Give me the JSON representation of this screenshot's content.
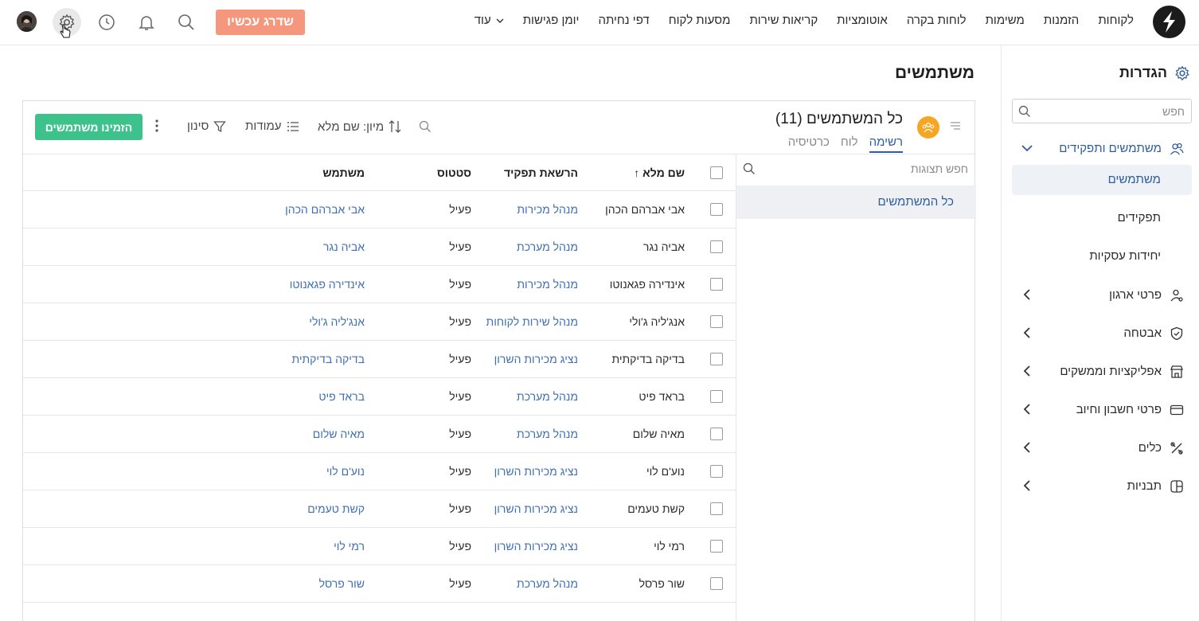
{
  "topbar": {
    "nav_items": [
      "לקוחות",
      "הזמנות",
      "משימות",
      "לוחות בקרה",
      "אוטומציות",
      "קריאות שירות",
      "מסעות לקוח",
      "דפי נחיתה",
      "יומן פגישות"
    ],
    "more_label": "עוד",
    "upgrade_label": "שדרג עכשיו"
  },
  "sidebar": {
    "title": "הגדרות",
    "search_placeholder": "חפש",
    "groups": [
      {
        "label": "משתמשים ותפקידים",
        "icon": "users-icon",
        "expanded": true
      },
      {
        "label": "פרטי ארגון",
        "icon": "org-user-icon"
      },
      {
        "label": "אבטחה",
        "icon": "shield-icon"
      },
      {
        "label": "אפליקציות וממשקים",
        "icon": "store-icon"
      },
      {
        "label": "פרטי חשבון וחיוב",
        "icon": "credit-card-icon"
      },
      {
        "label": "כלים",
        "icon": "tools-icon"
      },
      {
        "label": "תבניות",
        "icon": "template-icon"
      }
    ],
    "sub_items": [
      "משתמשים",
      "תפקידים",
      "יחידות עסקיות"
    ]
  },
  "page": {
    "title": "משתמשים"
  },
  "card": {
    "title": "כל המשתמשים (11)",
    "tabs": [
      "רשימה",
      "לוח",
      "כרטיסיה"
    ],
    "invite_label": "הזמינו משתמשים",
    "filter_label": "סינון",
    "columns_label": "עמודות",
    "sort_label": "מיון: שם מלא",
    "views_search_placeholder": "חפש תצוגות",
    "views": [
      "כל המשתמשים"
    ]
  },
  "table": {
    "headers": {
      "name": "שם מלא",
      "role": "הרשאת תפקיד",
      "status": "סטטוס",
      "user": "משתמש"
    },
    "sort_arrow": "↑",
    "rows": [
      {
        "name": "אבי אברהם הכהן",
        "role": "מנהל מכירות",
        "status": "פעיל",
        "user": "אבי אברהם הכהן"
      },
      {
        "name": "אביה נגר",
        "role": "מנהל מערכת",
        "status": "פעיל",
        "user": "אביה נגר"
      },
      {
        "name": "אינדירה פגאנוטו",
        "role": "מנהל מכירות",
        "status": "פעיל",
        "user": "אינדירה פגאנוטו"
      },
      {
        "name": "אנג'ליה ג'ולי",
        "role": "מנהל שירות לקוחות",
        "status": "פעיל",
        "user": "אנג'ליה ג'ולי"
      },
      {
        "name": "בדיקה בדיקתית",
        "role": "נציג מכירות השרון",
        "status": "פעיל",
        "user": "בדיקה בדיקתית"
      },
      {
        "name": "בראד פיט",
        "role": "מנהל מערכת",
        "status": "פעיל",
        "user": "בראד פיט"
      },
      {
        "name": "מאיה שלום",
        "role": "מנהל מערכת",
        "status": "פעיל",
        "user": "מאיה שלום"
      },
      {
        "name": "נוע'ם לוי",
        "role": "נציג מכירות השרון",
        "status": "פעיל",
        "user": "נוע'ם לוי"
      },
      {
        "name": "קשת טעמים",
        "role": "נציג מכירות השרון",
        "status": "פעיל",
        "user": "קשת טעמים"
      },
      {
        "name": "רמי לוי",
        "role": "נציג מכירות השרון",
        "status": "פעיל",
        "user": "רמי לוי"
      },
      {
        "name": "שור פרסל",
        "role": "מנהל מערכת",
        "status": "פעיל",
        "user": "שור פרסל"
      }
    ]
  },
  "colors": {
    "upgrade": "#f4977c",
    "invite": "#3ec28b",
    "link": "#3f6fb5",
    "accent": "#2d5d9f"
  }
}
